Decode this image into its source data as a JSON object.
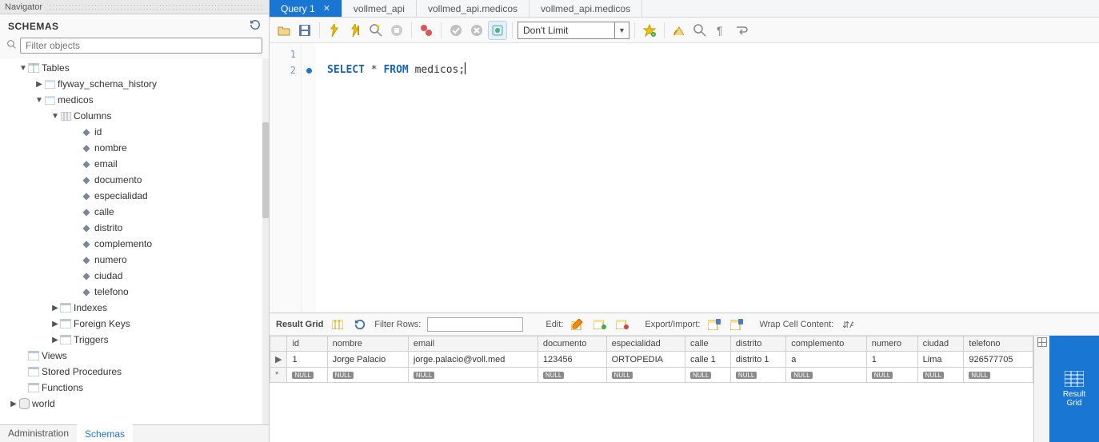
{
  "navigator": {
    "title": "Navigator",
    "schemas_label": "SCHEMAS",
    "filter_placeholder": "Filter objects",
    "tree": {
      "tables_label": "Tables",
      "flyway": "flyway_schema_history",
      "medicos_label": "medicos",
      "columns_label": "Columns",
      "columns": [
        "id",
        "nombre",
        "email",
        "documento",
        "especialidad",
        "calle",
        "distrito",
        "complemento",
        "numero",
        "ciudad",
        "telefono"
      ],
      "indexes_label": "Indexes",
      "fk_label": "Foreign Keys",
      "triggers_label": "Triggers",
      "views_label": "Views",
      "sp_label": "Stored Procedures",
      "functions_label": "Functions",
      "world_label": "world"
    },
    "bottom_tabs": {
      "admin": "Administration",
      "schemas": "Schemas"
    }
  },
  "editor_tabs": [
    "Query 1",
    "vollmed_api",
    "vollmed_api.medicos",
    "vollmed_api.medicos"
  ],
  "toolbar": {
    "limit_value": "Don't Limit"
  },
  "code": {
    "line_numbers": [
      "1",
      "2"
    ],
    "line2": {
      "select": "SELECT",
      "star": " * ",
      "from": "FROM",
      "rest": " medicos;"
    }
  },
  "result_toolbar": {
    "result_grid": "Result Grid",
    "filter_rows": "Filter Rows:",
    "edit": "Edit:",
    "export_import": "Export/Import:",
    "wrap": "Wrap Cell Content:"
  },
  "result_side_tab": "Result\nGrid",
  "grid": {
    "headers": [
      "id",
      "nombre",
      "email",
      "documento",
      "especialidad",
      "calle",
      "distrito",
      "complemento",
      "numero",
      "ciudad",
      "telefono"
    ],
    "row1": [
      "1",
      "Jorge Palacio",
      "jorge.palacio@voll.med",
      "123456",
      "ORTOPEDIA",
      "calle 1",
      "distrito 1",
      "a",
      "1",
      "Lima",
      "926577705"
    ],
    "null_label": "NULL"
  }
}
